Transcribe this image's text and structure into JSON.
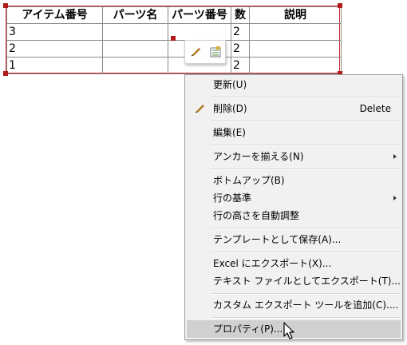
{
  "table": {
    "headers": [
      "アイテム番号",
      "パーツ名",
      "パーツ番号",
      "数",
      "説明"
    ],
    "rows": [
      [
        "3",
        "",
        "",
        "2",
        ""
      ],
      [
        "2",
        "",
        "",
        "2",
        ""
      ],
      [
        "1",
        "",
        "",
        "2",
        ""
      ]
    ]
  },
  "mini_toolbar": {
    "icons": [
      "pencil-icon",
      "table-properties-icon"
    ]
  },
  "context_menu": {
    "items": [
      {
        "label": "更新(U)",
        "shortcut": "",
        "submenu": false
      },
      {
        "label": "削除(D)",
        "shortcut": "Delete",
        "submenu": false,
        "icon": "pencil-eraser-icon"
      },
      {
        "label": "編集(E)",
        "shortcut": "",
        "submenu": false
      },
      {
        "label": "アンカーを揃える(N)",
        "shortcut": "",
        "submenu": true
      },
      {
        "label": "ボトムアップ(B)",
        "shortcut": "",
        "submenu": false
      },
      {
        "label": "行の基準",
        "shortcut": "",
        "submenu": true
      },
      {
        "label": "行の高さを自動調整",
        "shortcut": "",
        "submenu": false
      },
      {
        "label": "テンプレートとして保存(A)...",
        "shortcut": "",
        "submenu": false
      },
      {
        "label": "Excel にエクスポート(X)...",
        "shortcut": "",
        "submenu": false
      },
      {
        "label": "テキスト ファイルとしてエクスポート(T)...",
        "shortcut": "",
        "submenu": false
      },
      {
        "label": "カスタム エクスポート ツールを追加(C)....",
        "shortcut": "",
        "submenu": false
      },
      {
        "label": "プロパティ(P)...",
        "shortcut": "",
        "submenu": false,
        "highlighted": true
      }
    ]
  },
  "colors": {
    "selection_border": "#c92a2a",
    "menu_background": "#f1f1f1",
    "menu_highlight": "#d0d0d0"
  }
}
